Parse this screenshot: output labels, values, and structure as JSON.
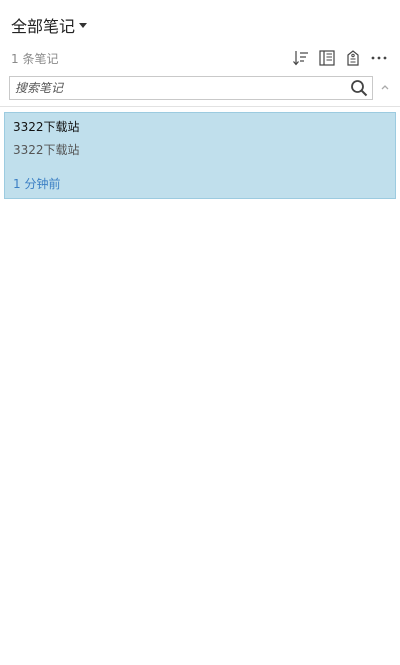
{
  "header": {
    "title": "全部笔记"
  },
  "meta": {
    "note_count": "1 条笔记"
  },
  "toolbar": {
    "icons": [
      "sort-icon",
      "notebook-view-icon",
      "tag-icon",
      "more-icon"
    ]
  },
  "search": {
    "placeholder": "搜索笔记",
    "value": ""
  },
  "notes": [
    {
      "title": "3322下载站",
      "snippet": "3322下载站",
      "time": "1 分钟前"
    }
  ],
  "colors": {
    "selected_bg": "#c0dfec",
    "selected_border": "#9ccbe0",
    "time_link": "#3b7fc4",
    "muted_text": "#8a8a8a"
  }
}
